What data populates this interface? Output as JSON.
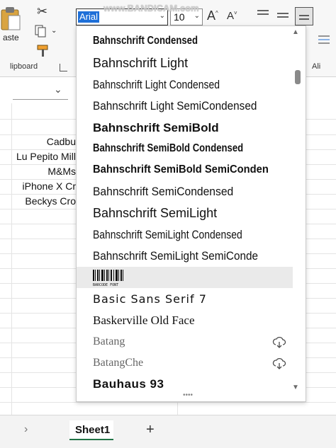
{
  "watermark": "www.BANDICAM.com",
  "ribbon": {
    "paste_label": "aste",
    "clipboard_label": "lipboard",
    "font_name_value": "Arial",
    "font_size_value": "10",
    "alignment_label": "Ali"
  },
  "cells": [
    "Cadbu",
    "Lu Pepito Mill",
    "M&Ms",
    "iPhone X Cr",
    "Beckys Cro"
  ],
  "font_list": [
    {
      "name": "Bahnschrift Condensed"
    },
    {
      "name": "Bahnschrift Light"
    },
    {
      "name": "Bahnschrift Light Condensed"
    },
    {
      "name": "Bahnschrift Light SemiCondensed"
    },
    {
      "name": "Bahnschrift SemiBold"
    },
    {
      "name": "Bahnschrift SemiBold Condensed"
    },
    {
      "name": "Bahnschrift SemiBold SemiConden"
    },
    {
      "name": "Bahnschrift SemiCondensed"
    },
    {
      "name": "Bahnschrift SemiLight"
    },
    {
      "name": "Bahnschrift SemiLight Condensed"
    },
    {
      "name": "Bahnschrift SemiLight SemiConde"
    },
    {
      "name": "BARCODE FONT"
    },
    {
      "name": "Basic Sans Serif 7"
    },
    {
      "name": "Baskerville Old Face"
    },
    {
      "name": "Batang"
    },
    {
      "name": "BatangChe"
    },
    {
      "name": "Bauhaus 93"
    }
  ],
  "sheet_tab": "Sheet1",
  "colors": {
    "selection_blue": "#1e6fd8",
    "sheet_tab_green": "#217346",
    "cloud_icon": "#4a4a4a"
  }
}
